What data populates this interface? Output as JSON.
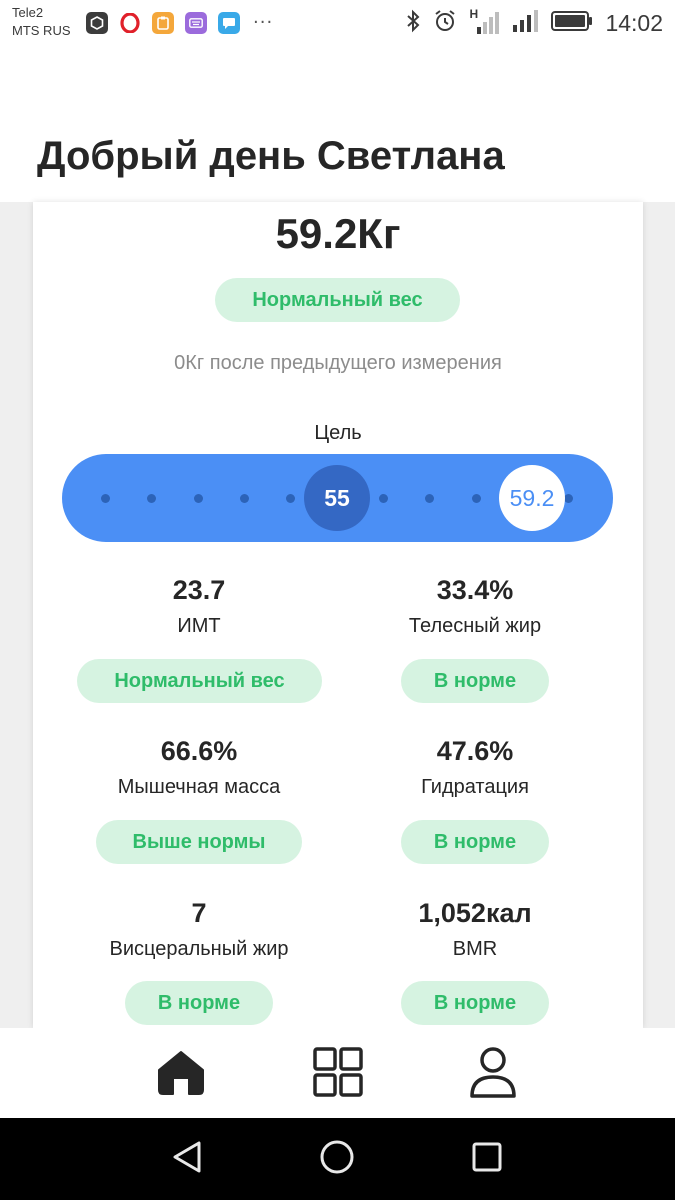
{
  "status_bar": {
    "carrier_1": "Tele2",
    "carrier_2": "MTS RUS",
    "more": "···",
    "network_type": "H",
    "time": "14:02"
  },
  "header": {
    "greeting": "Добрый день Светлана"
  },
  "weight_summary": {
    "value": "59.2Кг",
    "status": "Нормальный вес",
    "change_text": "0Кг после предыдущего измерения"
  },
  "goal": {
    "label": "Цель",
    "target": "55",
    "current": "59.2"
  },
  "metrics": [
    {
      "value": "23.7",
      "label": "ИМТ",
      "status": "Нормальный вес"
    },
    {
      "value": "33.4%",
      "label": "Телесный жир",
      "status": "В норме"
    },
    {
      "value": "66.6%",
      "label": "Мышечная масса",
      "status": "Выше нормы"
    },
    {
      "value": "47.6%",
      "label": "Гидратация",
      "status": "В норме"
    },
    {
      "value": "7",
      "label": "Висцеральный жир",
      "status": "В норме"
    },
    {
      "value": "1,052кал",
      "label": "BMR",
      "status": "В норме"
    }
  ],
  "bottom_nav": {
    "items": [
      "home-icon",
      "grid-icon",
      "profile-icon"
    ],
    "active": "home-icon"
  },
  "system_nav": {
    "items": [
      "back-icon",
      "home-circle-icon",
      "recents-icon"
    ]
  },
  "colors": {
    "accent_blue": "#4b8ff5",
    "status_green": "#2fbc6a",
    "pill_green_bg": "#d6f3e1"
  }
}
